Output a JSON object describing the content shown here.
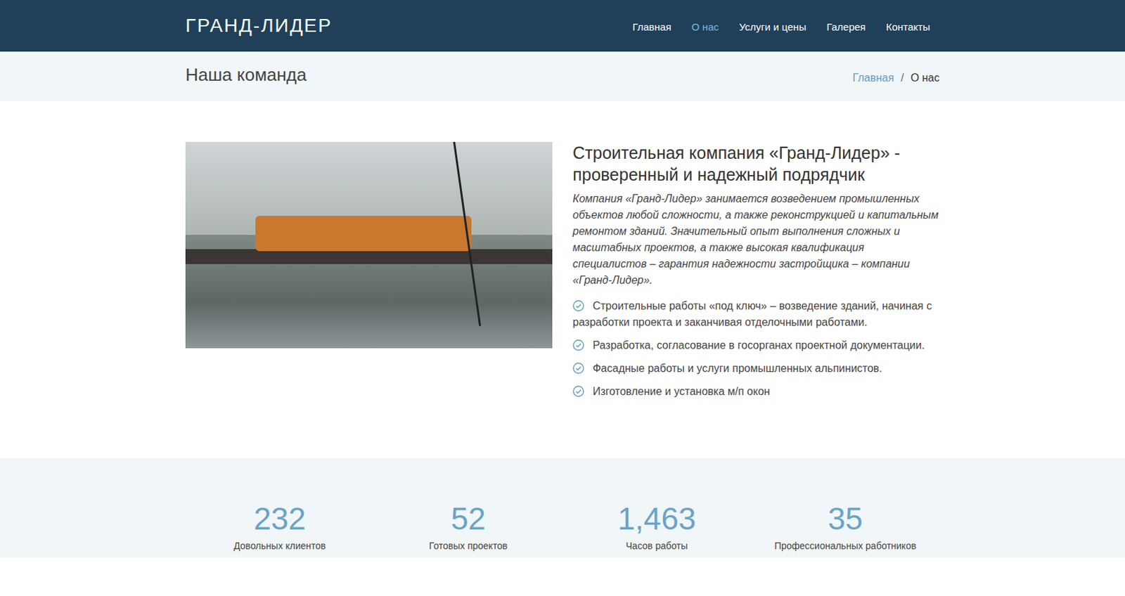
{
  "header": {
    "logo": "ГРАНД-ЛИДЕР",
    "nav": [
      {
        "label": "Главная",
        "selected": false
      },
      {
        "label": "О нас",
        "selected": true
      },
      {
        "label": "Услуги и цены",
        "selected": false
      },
      {
        "label": "Галерея",
        "selected": false
      },
      {
        "label": "Контакты",
        "selected": false
      }
    ]
  },
  "page_title": "Наша команда",
  "breadcrumbs": [
    {
      "label": "Главная",
      "link": true
    },
    {
      "label": "О нас",
      "link": false
    }
  ],
  "breadcrumb_separator": "/",
  "about": {
    "heading": "Строительная компания «Гранд-Лидер» - проверенный и надежный подрядчик",
    "intro": "Компания «Гранд-Лидер» занимается возведением промышленных объектов любой сложности, а также реконструкцией и капитальным ремонтом зданий. Значительный опыт выполнения сложных и масштабных проектов, а также высокая квалификация специалистов – гарантия надежности застройщика – компании «Гранд-Лидер».",
    "features": [
      "Строительные работы «под ключ» – возведение зданий, начиная с разработки проекта и заканчивая отделочными работами.",
      "Разработка, согласование в госорганах проектной документации.",
      "Фасадные работы и услуги промышленных альпинистов.",
      "Изготовление и установка м/п окон"
    ]
  },
  "stats": [
    {
      "value": "232",
      "label": "Довольных клиентов"
    },
    {
      "value": "52",
      "label": "Готовых проектов"
    },
    {
      "value": "1,463",
      "label": "Часов работы"
    },
    {
      "value": "35",
      "label": "Профессиональных работников"
    }
  ]
}
